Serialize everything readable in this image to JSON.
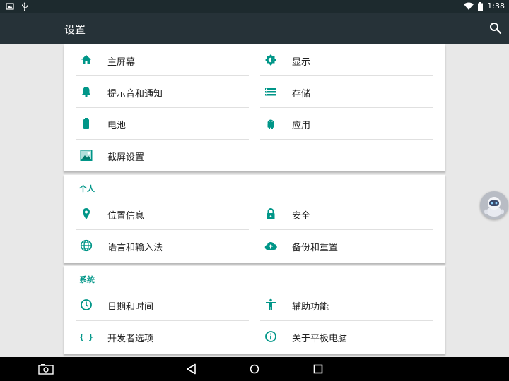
{
  "status_bar": {
    "time": "1:38"
  },
  "app_bar": {
    "title": "设置"
  },
  "sections": {
    "device": {
      "items": [
        {
          "label": "主屏幕",
          "icon": "home-icon"
        },
        {
          "label": "显示",
          "icon": "brightness-icon"
        },
        {
          "label": "提示音和通知",
          "icon": "bell-icon"
        },
        {
          "label": "存储",
          "icon": "storage-list-icon"
        },
        {
          "label": "电池",
          "icon": "battery-icon"
        },
        {
          "label": "应用",
          "icon": "android-icon"
        },
        {
          "label": "截屏设置",
          "icon": "screenshot-image-icon"
        }
      ]
    },
    "personal": {
      "header": "个人",
      "items": [
        {
          "label": "位置信息",
          "icon": "location-pin-icon"
        },
        {
          "label": "安全",
          "icon": "lock-icon"
        },
        {
          "label": "语言和输入法",
          "icon": "globe-icon"
        },
        {
          "label": "备份和重置",
          "icon": "cloud-upload-icon"
        }
      ]
    },
    "system": {
      "header": "系统",
      "items": [
        {
          "label": "日期和时间",
          "icon": "clock-icon"
        },
        {
          "label": "辅助功能",
          "icon": "accessibility-icon"
        },
        {
          "label": "开发者选项",
          "icon": "braces-icon"
        },
        {
          "label": "关于平板电脑",
          "icon": "info-icon"
        }
      ]
    }
  },
  "colors": {
    "accent": "#009688",
    "app_bar": "#263238",
    "status_bar": "#1d2a2e"
  }
}
